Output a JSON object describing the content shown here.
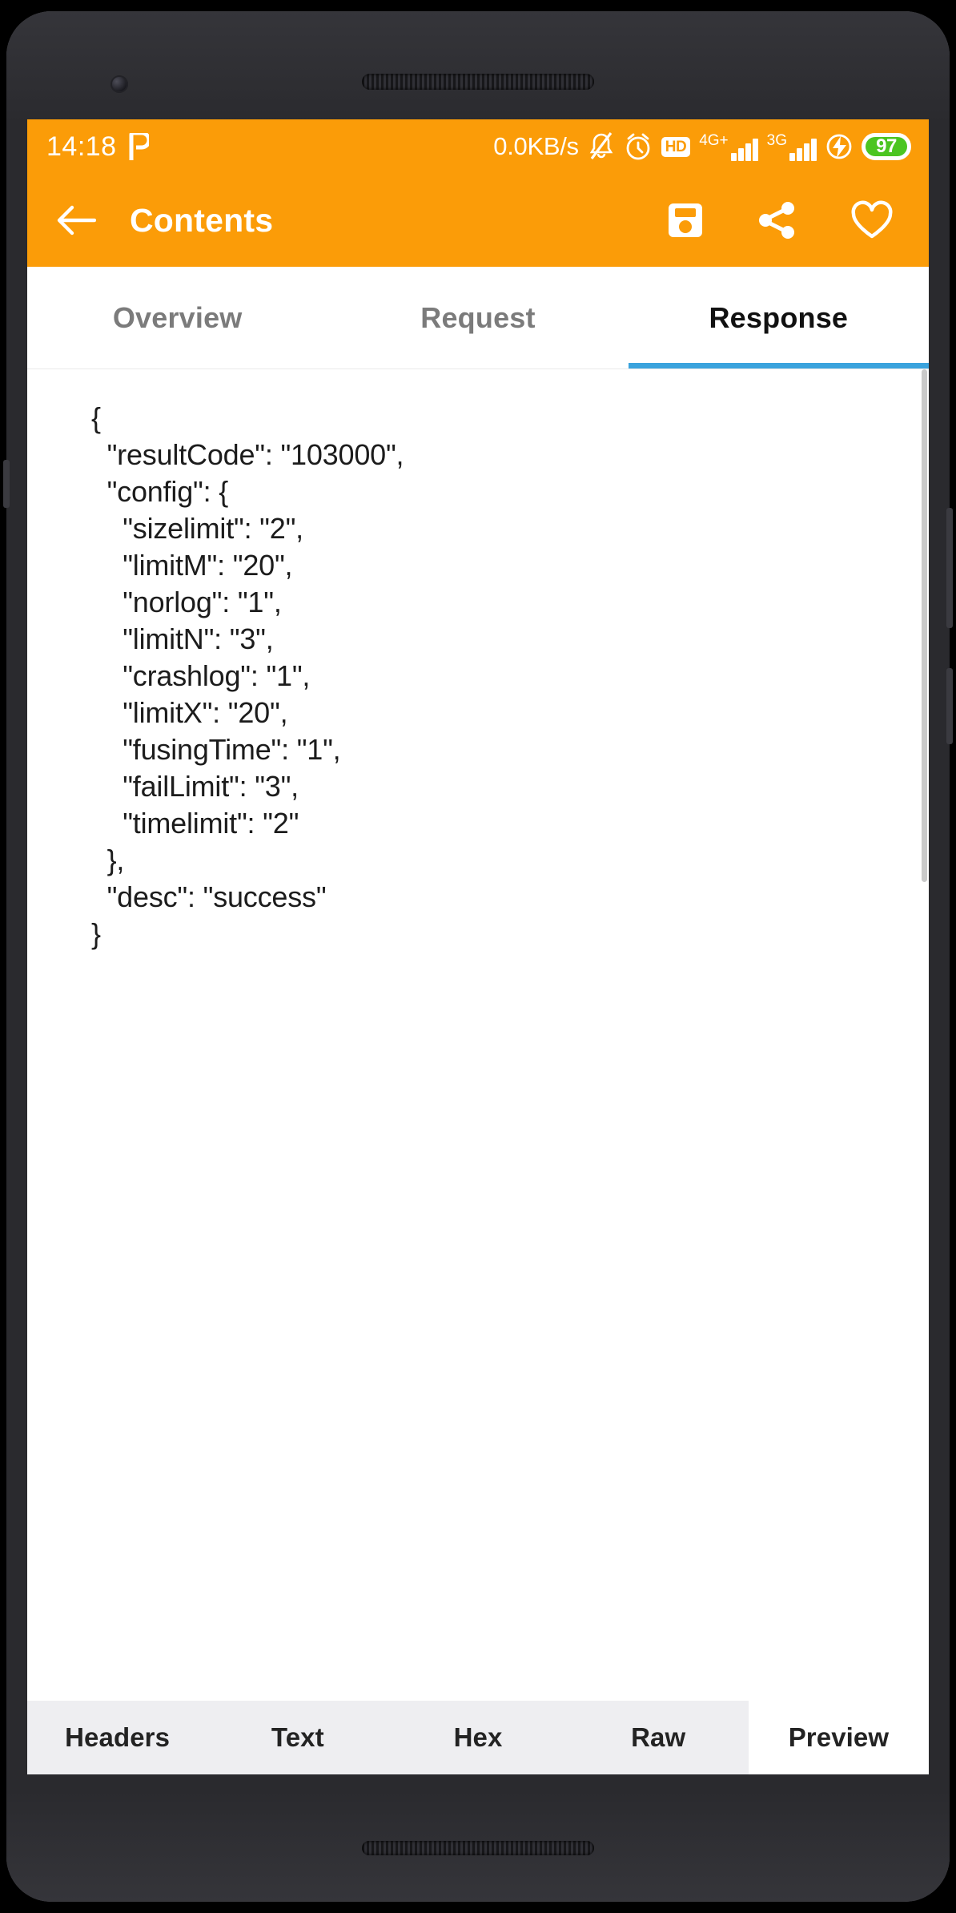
{
  "statusbar": {
    "time": "14:18",
    "left_icon": "pocket-app-icon",
    "network_speed": "0.0KB/s",
    "icons": [
      "bell-muted-icon",
      "alarm-clock-icon",
      "hd-badge-icon",
      "signal-4g-plus-icon",
      "signal-3g-icon",
      "charging-bolt-icon",
      "battery-icon"
    ],
    "hd_label": "HD",
    "sim1_label": "4G+",
    "sim2_label": "3G",
    "battery_percent": "97"
  },
  "appbar": {
    "title": "Contents",
    "back_icon": "back-arrow-icon",
    "save_icon": "save-floppy-icon",
    "share_icon": "share-icon",
    "favorite_icon": "heart-outline-icon"
  },
  "tabs": {
    "items": [
      {
        "label": "Overview",
        "active": false
      },
      {
        "label": "Request",
        "active": false
      },
      {
        "label": "Response",
        "active": true
      }
    ],
    "indicator_color": "#3aa3dd"
  },
  "response_body": {
    "lines": [
      "{",
      "  \"resultCode\": \"103000\",",
      "  \"config\": {",
      "    \"sizelimit\": \"2\",",
      "    \"limitM\": \"20\",",
      "    \"norlog\": \"1\",",
      "    \"limitN\": \"3\",",
      "    \"crashlog\": \"1\",",
      "    \"limitX\": \"20\",",
      "    \"fusingTime\": \"1\",",
      "    \"failLimit\": \"3\",",
      "    \"timelimit\": \"2\"",
      "  },",
      "  \"desc\": \"success\"",
      "}"
    ],
    "parsed": {
      "resultCode": "103000",
      "config": {
        "sizelimit": "2",
        "limitM": "20",
        "norlog": "1",
        "limitN": "3",
        "crashlog": "1",
        "limitX": "20",
        "fusingTime": "1",
        "failLimit": "3",
        "timelimit": "2"
      },
      "desc": "success"
    }
  },
  "bottombar": {
    "items": [
      {
        "label": "Headers",
        "active": false
      },
      {
        "label": "Text",
        "active": false
      },
      {
        "label": "Hex",
        "active": false
      },
      {
        "label": "Raw",
        "active": false
      },
      {
        "label": "Preview",
        "active": true
      }
    ]
  },
  "colors": {
    "accent": "#fb9c08",
    "tab_indicator": "#3aa3dd",
    "battery_green": "#4cc521"
  }
}
